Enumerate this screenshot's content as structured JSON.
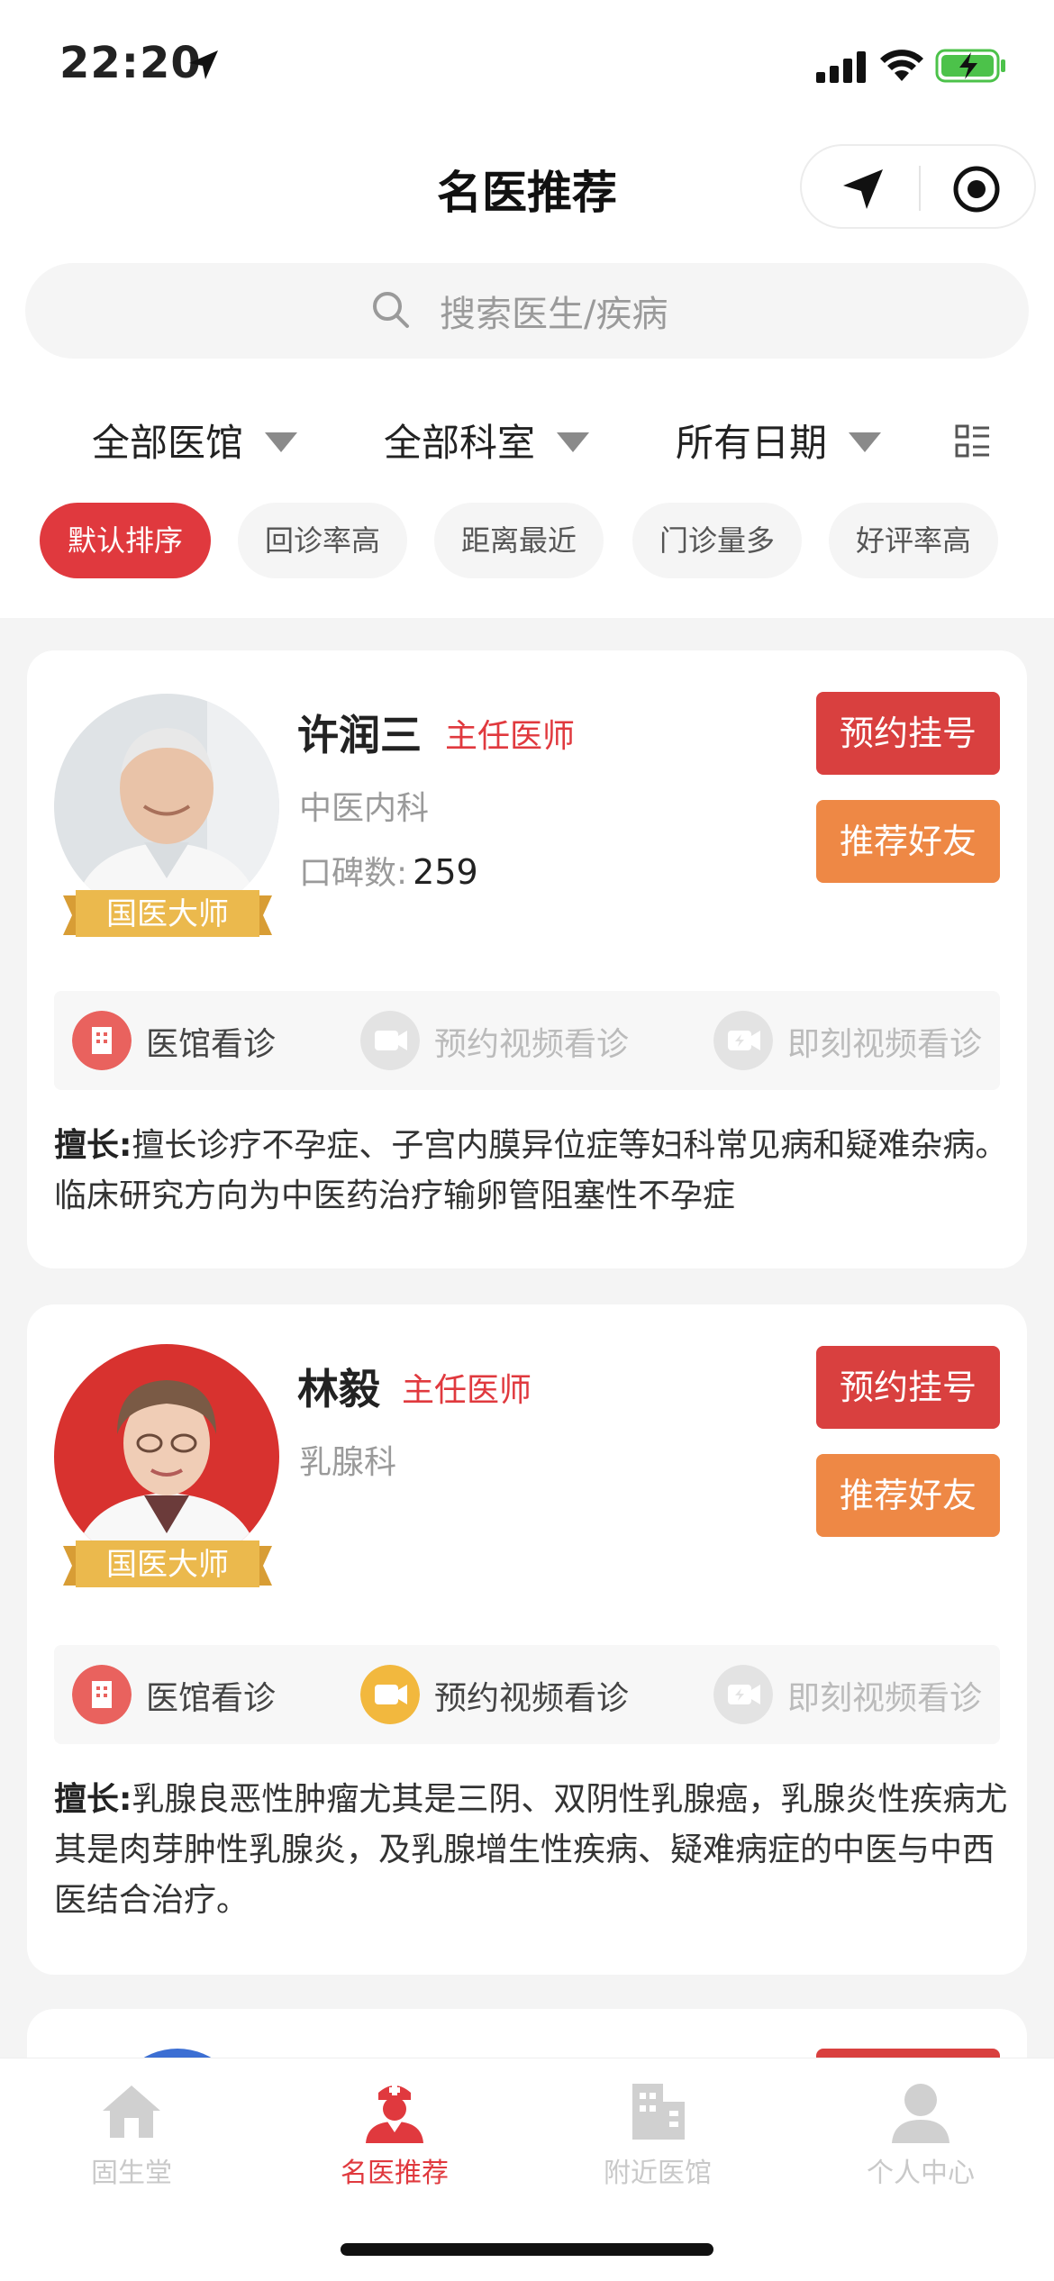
{
  "status": {
    "time": "22:20"
  },
  "header": {
    "title": "名医推荐"
  },
  "search": {
    "placeholder": "搜索医生/疾病"
  },
  "filters": [
    {
      "label": "全部医馆"
    },
    {
      "label": "全部科室"
    },
    {
      "label": "所有日期"
    }
  ],
  "sort_chips": [
    {
      "label": "默认排序",
      "active": true
    },
    {
      "label": "回诊率高",
      "active": false
    },
    {
      "label": "距离最近",
      "active": false
    },
    {
      "label": "门诊量多",
      "active": false
    },
    {
      "label": "好评率高",
      "active": false
    }
  ],
  "doctors": [
    {
      "name": "许润三",
      "title": "主任医师",
      "department": "中医内科",
      "rating_label": "口碑数:",
      "rating_value": "259",
      "badge": "国医大师",
      "book_label": "预约挂号",
      "recommend_label": "推荐好友",
      "services": [
        {
          "label": "医馆看诊",
          "enabled": true
        },
        {
          "label": "预约视频看诊",
          "enabled": false
        },
        {
          "label": "即刻视频看诊",
          "enabled": false
        }
      ],
      "specialty_label": "擅长:",
      "specialty": "擅长诊疗不孕症、子宫内膜异位症等妇科常见病和疑难杂病。临床研究方向为中医药治疗输卵管阻塞性不孕症"
    },
    {
      "name": "林毅",
      "title": "主任医师",
      "department": "乳腺科",
      "badge": "国医大师",
      "book_label": "预约挂号",
      "recommend_label": "推荐好友",
      "services": [
        {
          "label": "医馆看诊",
          "enabled": true
        },
        {
          "label": "预约视频看诊",
          "enabled": true
        },
        {
          "label": "即刻视频看诊",
          "enabled": false
        }
      ],
      "specialty_label": "擅长:",
      "specialty": "乳腺良恶性肿瘤尤其是三阴、双阴性乳腺癌，乳腺炎性疾病尤其是肉芽肿性乳腺炎，及乳腺增生性疾病、疑难病症的中医与中西医结合治疗。"
    }
  ],
  "tabs": [
    {
      "label": "固生堂",
      "icon": "home-icon",
      "active": false
    },
    {
      "label": "名医推荐",
      "icon": "doctor-icon",
      "active": true
    },
    {
      "label": "附近医馆",
      "icon": "building-icon",
      "active": false
    },
    {
      "label": "个人中心",
      "icon": "person-icon",
      "active": false
    }
  ],
  "colors": {
    "accent": "#e0393e",
    "orange": "#ee8845",
    "gold": "#e9b64a"
  }
}
